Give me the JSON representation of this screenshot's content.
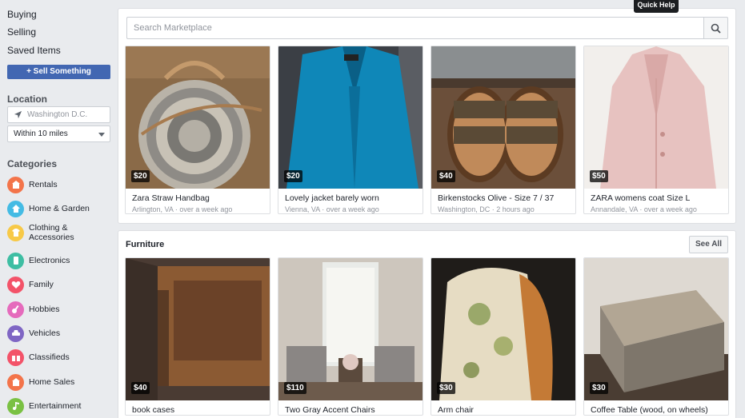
{
  "sidebar": {
    "links": [
      "Buying",
      "Selling",
      "Saved Items"
    ],
    "sell_button": "+ Sell Something",
    "location_heading": "Location",
    "location_value": "Washington D.C.",
    "radius_value": "Within 10 miles",
    "categories_heading": "Categories",
    "categories": [
      {
        "label": "Rentals",
        "color": "#f3744a",
        "icon": "house-icon"
      },
      {
        "label": "Home & Garden",
        "color": "#44bbe4",
        "icon": "home-garden-icon"
      },
      {
        "label": "Clothing &\nAccessories",
        "color": "#f7c947",
        "icon": "shirt-icon"
      },
      {
        "label": "Electronics",
        "color": "#3ebea3",
        "icon": "phone-icon"
      },
      {
        "label": "Family",
        "color": "#f35369",
        "icon": "heart-icon"
      },
      {
        "label": "Hobbies",
        "color": "#e56bbc",
        "icon": "guitar-icon"
      },
      {
        "label": "Vehicles",
        "color": "#7f66c4",
        "icon": "car-icon"
      },
      {
        "label": "Classifieds",
        "color": "#f35369",
        "icon": "gift-icon"
      },
      {
        "label": "Home Sales",
        "color": "#f3744a",
        "icon": "house-sale-icon"
      },
      {
        "label": "Entertainment",
        "color": "#7ac143",
        "icon": "music-icon"
      }
    ]
  },
  "search": {
    "placeholder": "Search Marketplace"
  },
  "quick_help": "Quick Help",
  "listings": [
    {
      "price": "$20",
      "title": "Zara Straw Handbag",
      "location": "Arlington, VA",
      "time": "over a week ago"
    },
    {
      "price": "$20",
      "title": "Lovely jacket barely worn",
      "location": "Vienna, VA",
      "time": "over a week ago"
    },
    {
      "price": "$40",
      "title": "Birkenstocks Olive - Size 7 / 37",
      "location": "Washington, DC",
      "time": "2 hours ago"
    },
    {
      "price": "$50",
      "title": "ZARA womens coat Size L",
      "location": "Annandale, VA",
      "time": "over a week ago"
    }
  ],
  "furniture": {
    "heading": "Furniture",
    "see_all": "See All",
    "items": [
      {
        "price": "$40",
        "title": "book cases"
      },
      {
        "price": "$110",
        "title": "Two Gray Accent Chairs"
      },
      {
        "price": "$30",
        "title": "Arm chair"
      },
      {
        "price": "$30",
        "title": "Coffee Table (wood, on wheels)"
      }
    ]
  },
  "separator": " · "
}
